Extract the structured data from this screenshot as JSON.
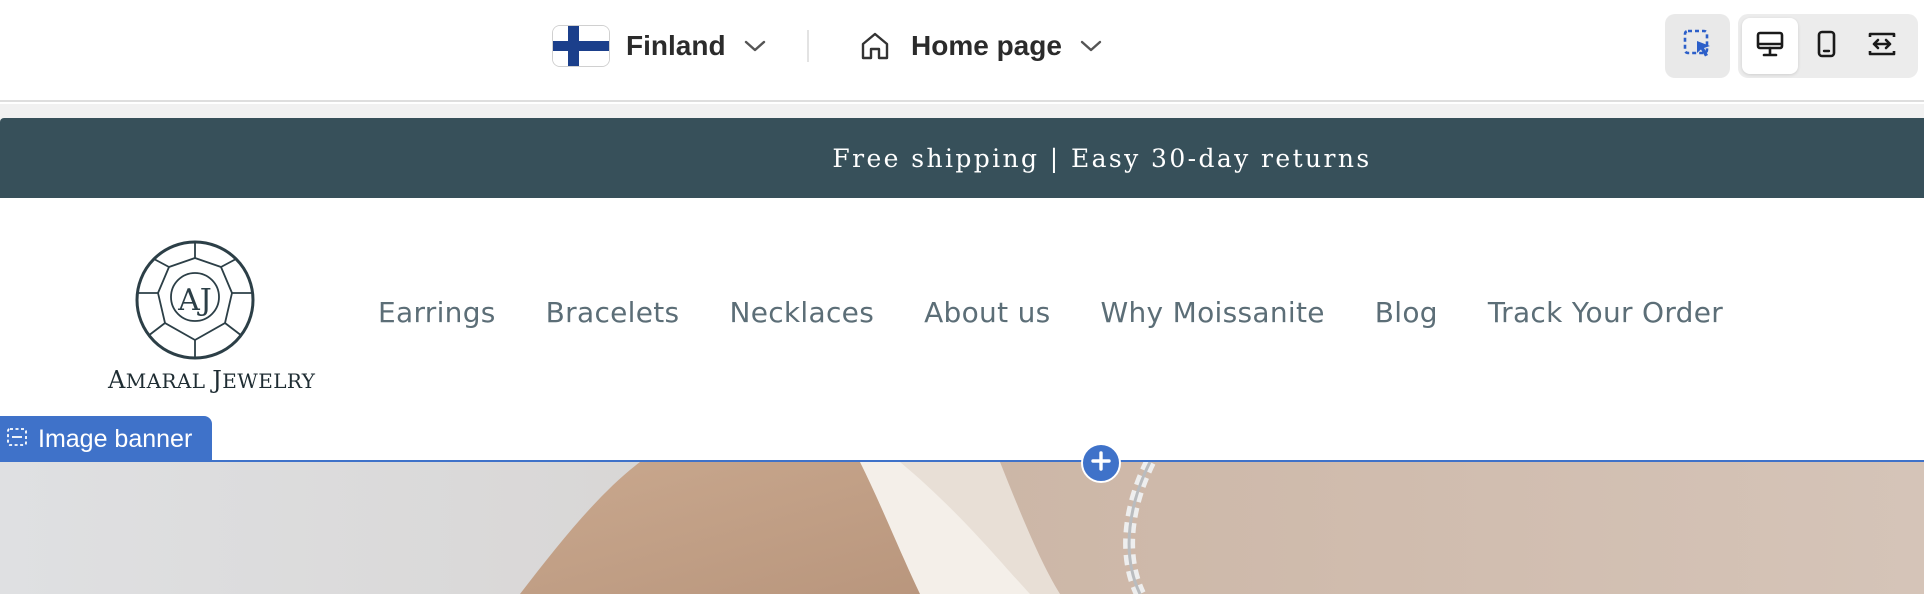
{
  "editor": {
    "country_selector": {
      "label": "Finland",
      "icon": "finland-flag-icon"
    },
    "page_selector": {
      "label": "Home page",
      "icon": "home-icon"
    },
    "tools": {
      "select": "select-element-icon"
    },
    "device_views": [
      {
        "icon": "desktop-icon",
        "active": true
      },
      {
        "icon": "mobile-icon",
        "active": false
      },
      {
        "icon": "full-width-icon",
        "active": false
      }
    ],
    "accent_color": "#3f72c9"
  },
  "store": {
    "announcement": "Free shipping | Easy 30-day returns",
    "announcement_bg": "#37505a",
    "logo": {
      "monogram": "AJ",
      "name_big_1": "A",
      "name_small_1": "MARAL ",
      "name_big_2": "J",
      "name_small_2": "EWELRY"
    },
    "nav": [
      "Earrings",
      "Bracelets",
      "Necklaces",
      "About us",
      "Why Moissanite",
      "Blog",
      "Track Your Order"
    ]
  },
  "section": {
    "label": "Image banner",
    "icon": "section-icon",
    "add_icon": "plus-icon"
  }
}
